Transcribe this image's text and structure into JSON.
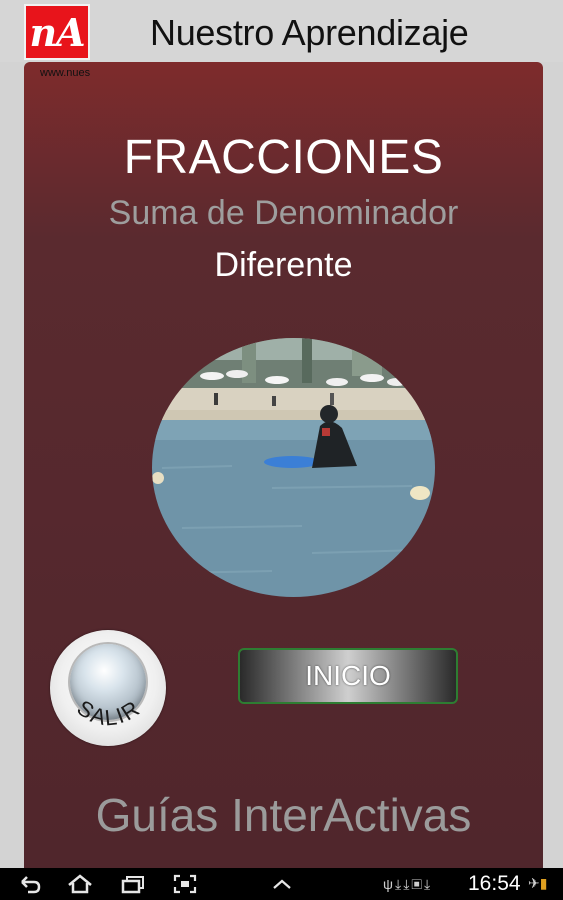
{
  "header": {
    "logo_text": "nA",
    "title": "Nuestro Aprendizaje"
  },
  "panel": {
    "url_text": "www.nues",
    "title": "FRACCIONES",
    "subtitle": "Suma de Denominador",
    "subtitle2": "Diferente",
    "footer_text": "Guías InterActivas"
  },
  "buttons": {
    "salir_label": "SALIR",
    "inicio_label": "INICIO"
  },
  "statusbar": {
    "time": "16:54",
    "nav_icons": [
      "back-icon",
      "home-icon",
      "recent-apps-icon",
      "screenshot-icon",
      "up-chevron-icon"
    ],
    "status_icons": [
      "usb-icon",
      "download-icon",
      "download-icon",
      "image-icon",
      "download-icon",
      "airplane-icon",
      "battery-icon"
    ]
  },
  "colors": {
    "logo_bg": "#e8141b",
    "panel_top": "#7e2b2c",
    "panel_bottom": "#50262c",
    "inicio_border": "#2e7d32"
  }
}
